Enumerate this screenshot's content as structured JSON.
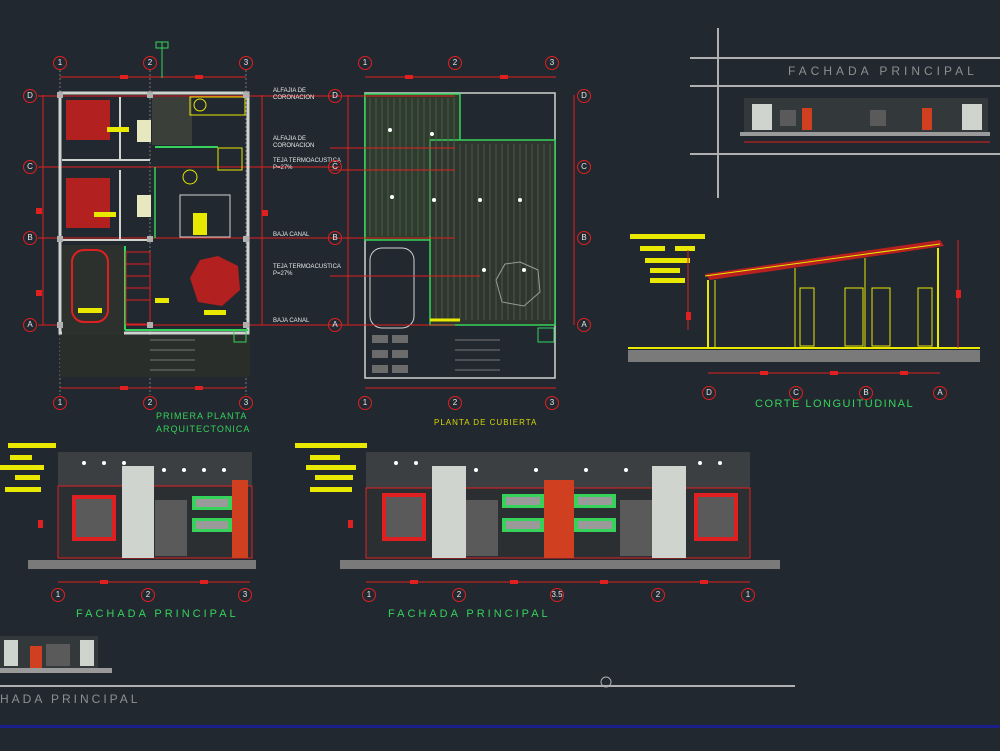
{
  "drawing": {
    "plan_title": "PRIMERA PLANTA ARQUITECTONICA",
    "roof_title": "PLANTA DE CUBIERTA",
    "section_title": "CORTE LONGUITUDINAL",
    "facade_titles": [
      "FACHADA PRINCIPAL",
      "FACHADA PRINCIPAL",
      "FACHADA PRINCIPAL",
      "FACHADA PRINCIPAL"
    ],
    "facade_partial": "HADA PRINCIPAL",
    "notes": [
      "ALFAJIA DE CORONACION",
      "ALFAJIA DE CORONACION",
      "TEJA TERMOACUSTICA P=27%",
      "BAJA CANAL",
      "TEJA TERMOACUSTICA P=27%",
      "BAJA CANAL"
    ],
    "grid_numbers": [
      "1",
      "2",
      "3"
    ],
    "grid_letters": [
      "D",
      "C",
      "B",
      "A"
    ],
    "section_axes": [
      "D",
      "C",
      "B",
      "A"
    ],
    "facade2_axes": [
      "1",
      "2",
      "3.5",
      "2",
      "1"
    ]
  },
  "colors": {
    "background": "#212830",
    "dim": "#e02020",
    "wall": "#e8e8e8",
    "green": "#35d35a",
    "yellow": "#d8d800"
  }
}
